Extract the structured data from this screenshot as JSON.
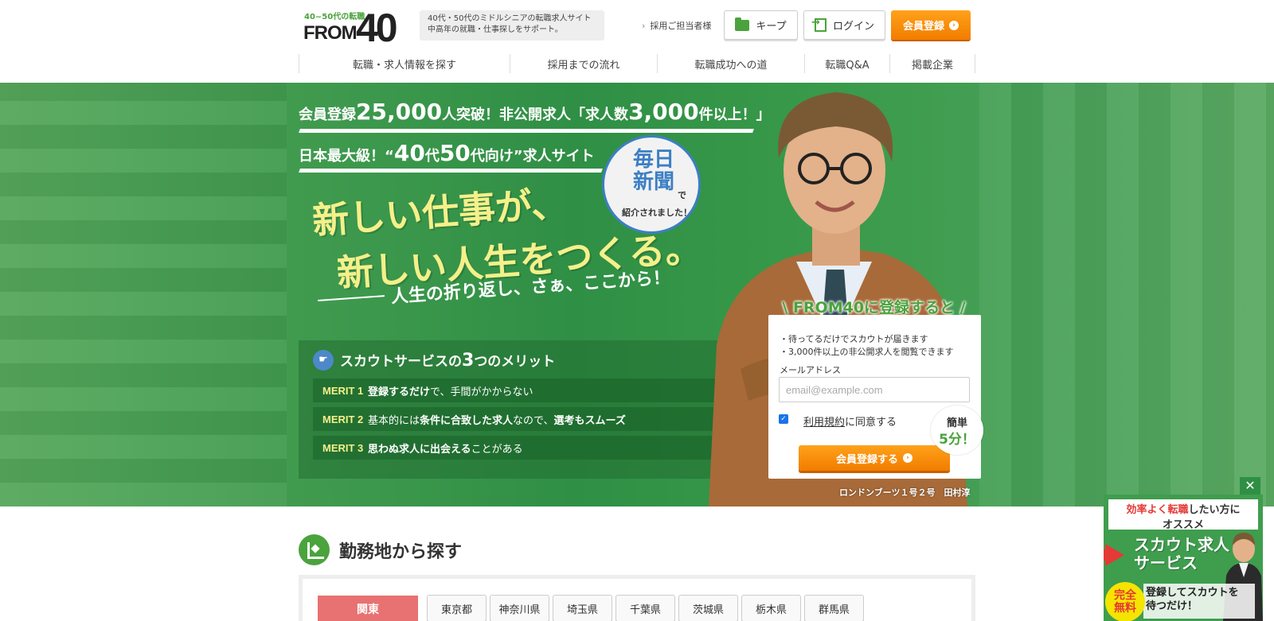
{
  "header": {
    "logo_small": "40~50代の転職",
    "logo_main": "FROM",
    "logo_num": "40",
    "tagline_line1": "40代・50代のミドルシニアの転職求人サイト",
    "tagline_line2": "中高年の就職・仕事探しをサポート。",
    "recruiter_link": "採用ご担当者様",
    "keep_label": "キープ",
    "login_label": "ログイン",
    "register_label": "会員登録"
  },
  "nav": [
    {
      "label": "転職・求人情報を探す"
    },
    {
      "label": "採用までの流れ"
    },
    {
      "label": "転職成功への道"
    },
    {
      "label": "転職Q&A"
    },
    {
      "label": "掲載企業"
    }
  ],
  "hero": {
    "copy1_a": "会員登録",
    "copy1_b": "25,000",
    "copy1_c": "人突破！非公開求人「求人数",
    "copy1_d": "3,000",
    "copy1_e": "件以上！」",
    "copy2_a": "日本最大級！“",
    "copy2_b": "40",
    "copy2_c": "代",
    "copy2_d": "50",
    "copy2_e": "代向け”求人サイト",
    "badge_line1": "毎日",
    "badge_line2": "新聞",
    "badge_de": "で",
    "badge_line3": "紹介されました！",
    "main_line1": "新しい仕事が、",
    "main_line2": "新しい人生をつくる。",
    "sub_copy": "人生の折り返し、さぁ、ここから！",
    "merit_title_a": "スカウトサービスの",
    "merit_title_b": "3",
    "merit_title_c": "つのメリット",
    "merits": [
      {
        "label": "MERIT 1",
        "bold": "登録するだけ",
        "rest": "で、手間がかからない"
      },
      {
        "label": "MERIT 2",
        "pre": "基本的には",
        "bold": "条件に合致した求人",
        "mid": "なので、",
        "bold2": "選考もスムーズ"
      },
      {
        "label": "MERIT 3",
        "bold": "思わぬ求人に出会える",
        "rest": "ことがある"
      }
    ],
    "caption": "ロンドンブーツ１号２号　田村淳"
  },
  "register_form": {
    "title": "\\ FROM40に登録すると /",
    "benefit1": "・待ってるだけでスカウトが届きます",
    "benefit2": "・3,000件以上の非公開求人を閲覧できます",
    "email_label": "メールアドレス",
    "email_placeholder": "email@example.com",
    "terms_link": "利用規約",
    "terms_rest": "に同意する",
    "submit_label": "会員登録する",
    "bubble_line1": "簡単",
    "bubble_line2": "5分！"
  },
  "area_section": {
    "title": "勤務地から探す",
    "region": "関東",
    "prefectures": [
      "東京都",
      "神奈川県",
      "埼玉県",
      "千葉県",
      "茨城県",
      "栃木県",
      "群馬県"
    ]
  },
  "float_ad": {
    "close": "✕",
    "top_red": "効率よく転職",
    "top_rest": "したい方に",
    "top_line2": "オススメ",
    "main_line1": "スカウト求人",
    "main_line2": "サービス",
    "badge_line1": "完全",
    "badge_line2": "無料",
    "bottom_line1": "登録してスカウトを",
    "bottom_line2": "待つだけ！"
  },
  "colors": {
    "brand_green": "#4aa33c",
    "accent_orange": "#f28600",
    "region_red": "#e87171"
  }
}
